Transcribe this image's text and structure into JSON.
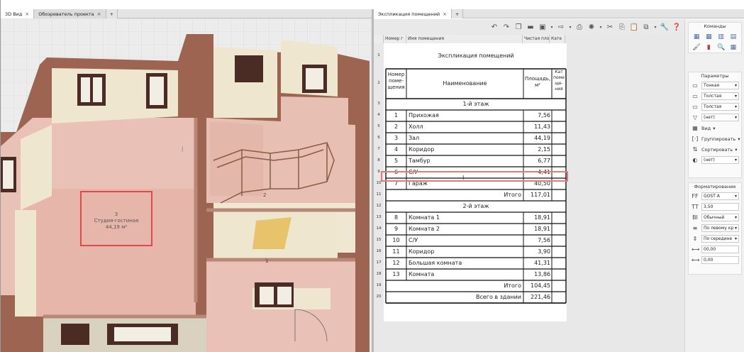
{
  "left_tabs": [
    {
      "label": "3D Вид",
      "active": true
    },
    {
      "label": "Обозреватель проекта",
      "active": false
    }
  ],
  "room_label": {
    "number": "3",
    "name": "Студия-гостиная",
    "area": "44,19 м²"
  },
  "view_labels": {
    "room2": "2",
    "room1": "1",
    "tick": "|"
  },
  "right_tabs": [
    {
      "label": "Экспликация помещений",
      "active": true
    }
  ],
  "column_headers": [
    "Номер г",
    "Имя помещения",
    "Чистая плоі",
    "Кате"
  ],
  "row_numbers": [
    "1",
    "2",
    "3",
    "4",
    "5",
    "6",
    "7",
    "8",
    "9",
    "10",
    "11",
    "12",
    "13",
    "14",
    "15",
    "16",
    "17",
    "18",
    "19",
    "20"
  ],
  "schedule": {
    "title": "Экспликация помещений",
    "header": {
      "num": "Номер поме- щения",
      "name": "Наименование",
      "area": "Площадь, м²",
      "cat": "Кат поме ще- ния"
    },
    "floor1_title": "1-й этаж",
    "floor1_rows": [
      {
        "num": "1",
        "name": "Прихожая",
        "area": "7,56"
      },
      {
        "num": "2",
        "name": "Холл",
        "area": "11,43"
      },
      {
        "num": "3",
        "name": "Зал",
        "area": "44,19"
      },
      {
        "num": "4",
        "name": "Коридор",
        "area": "2,15"
      },
      {
        "num": "5",
        "name": "Тамбур",
        "area": "6,77"
      },
      {
        "num": "6",
        "name": "С/У",
        "area": "4,41"
      },
      {
        "num": "7",
        "name": "Гараж",
        "area": "40,50"
      }
    ],
    "floor1_total": {
      "label": "Итого",
      "value": "117,01"
    },
    "floor2_title": "2-й этаж",
    "floor2_rows": [
      {
        "num": "8",
        "name": "Комната 1",
        "area": "18,91"
      },
      {
        "num": "9",
        "name": "Комната 2",
        "area": "18,91"
      },
      {
        "num": "10",
        "name": "С/У",
        "area": "7,56"
      },
      {
        "num": "11",
        "name": "Коридор",
        "area": "3,90"
      },
      {
        "num": "12",
        "name": "Большая комната",
        "area": "41,31"
      },
      {
        "num": "13",
        "name": "Комната",
        "area": "13,86"
      }
    ],
    "floor2_total": {
      "label": "Итого",
      "value": "104,45"
    },
    "grand_total": {
      "label": "Всего в здании",
      "value": "221,46"
    }
  },
  "side_panel": {
    "commands_title": "Команды",
    "params_title": "Параметры",
    "params": [
      {
        "icon": "line-weight-icon",
        "value": "Тонкая"
      },
      {
        "icon": "line-weight-icon",
        "value": "Толстая"
      },
      {
        "icon": "line-weight-icon",
        "value": "Толстая"
      },
      {
        "icon": "filter-icon",
        "value": "(нет)"
      }
    ],
    "buttons": [
      {
        "icon": "view-icon",
        "label": "Вид"
      },
      {
        "icon": "group-icon",
        "label": "Группировать"
      },
      {
        "icon": "sort-icon",
        "label": "Сортировать"
      }
    ],
    "last_param": "(нет)",
    "format_title": "Форматирование",
    "format": [
      {
        "icon": "font-icon",
        "value": "GOST A"
      },
      {
        "icon": "font-size-icon",
        "value": "3,50"
      },
      {
        "icon": "bold-icon",
        "value": "Обычный"
      },
      {
        "icon": "align-h-icon",
        "value": "По левому кр"
      },
      {
        "icon": "align-v-icon",
        "value": "По середине"
      },
      {
        "icon": "indent-icon",
        "value": "00,00"
      },
      {
        "icon": "indent-icon",
        "value": "0,00"
      }
    ]
  },
  "colors": {
    "highlight": "#e0494b",
    "wall": "#9c6451",
    "floor": "#e8b8ae"
  }
}
